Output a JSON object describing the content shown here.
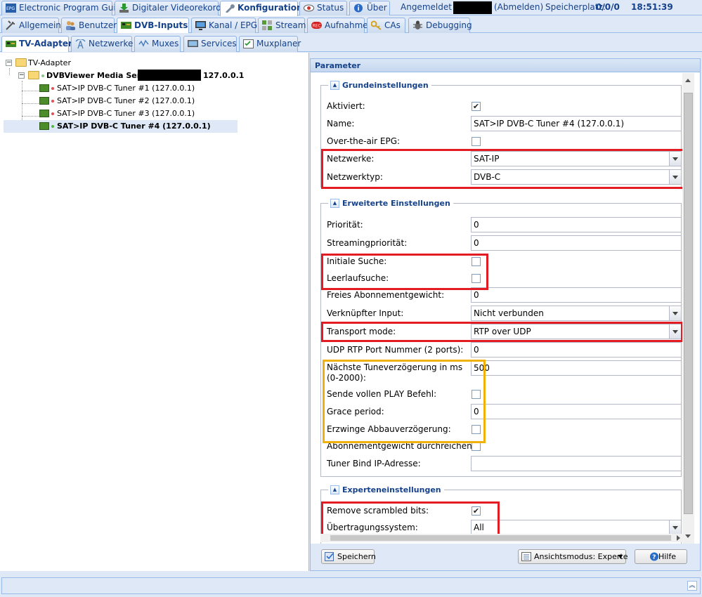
{
  "top_tabs": [
    {
      "label": "Electronic Program Guide",
      "icon": "epg-icon"
    },
    {
      "label": "Digitaler Videorekorder",
      "icon": "download-icon"
    },
    {
      "label": "Konfiguration",
      "icon": "wrench-icon"
    },
    {
      "label": "Status",
      "icon": "eye-icon"
    },
    {
      "label": "Über",
      "icon": "info-icon"
    }
  ],
  "top_info": {
    "logged_in": "Angemeldet als",
    "logout": "(Abmelden)",
    "storage_label": "Speicherplatz:",
    "storage_value": "0/0/0",
    "time": "18:51:39"
  },
  "config_tabs": [
    {
      "label": "Allgemein",
      "icon": "tools-icon"
    },
    {
      "label": "Benutzer",
      "icon": "users-icon"
    },
    {
      "label": "DVB-Inputs",
      "icon": "tuner-card-icon"
    },
    {
      "label": "Kanal / EPG",
      "icon": "tv-icon"
    },
    {
      "label": "Stream",
      "icon": "stream-icon"
    },
    {
      "label": "Aufnahme",
      "icon": "rec-icon"
    },
    {
      "label": "CAs",
      "icon": "key-icon"
    },
    {
      "label": "Debugging",
      "icon": "bug-icon"
    }
  ],
  "dvb_tabs": [
    {
      "label": "TV-Adapter",
      "icon": "tuner-card-icon"
    },
    {
      "label": "Netzwerke",
      "icon": "antenna-icon"
    },
    {
      "label": "Muxes",
      "icon": "mux-icon"
    },
    {
      "label": "Services",
      "icon": "services-icon"
    },
    {
      "label": "Muxplaner",
      "icon": "checklist-icon"
    }
  ],
  "tree": {
    "root": "TV-Adapter",
    "server_name": "DVBViewer Media Server",
    "server_ip": "127.0.0.1",
    "tuners": [
      {
        "label": "SAT>IP DVB-C Tuner #1 (127.0.0.1)",
        "status_color": "#e0505a"
      },
      {
        "label": "SAT>IP DVB-C Tuner #2 (127.0.0.1)",
        "status_color": "#e0505a"
      },
      {
        "label": "SAT>IP DVB-C Tuner #3 (127.0.0.1)",
        "status_color": "#e0505a"
      },
      {
        "label": "SAT>IP DVB-C Tuner #4 (127.0.0.1)",
        "status_color": "#4cbb3f"
      }
    ]
  },
  "params": {
    "title": "Parameter",
    "basic": {
      "legend": "Grundeinstellungen",
      "enabled_label": "Aktiviert:",
      "enabled": true,
      "name_label": "Name:",
      "name_value": "SAT>IP DVB-C Tuner #4 (127.0.0.1)",
      "ota_epg_label": "Over-the-air EPG:",
      "ota_epg": false,
      "networks_label": "Netzwerke:",
      "networks_value": "SAT-IP",
      "network_type_label": "Netzwerktyp:",
      "network_type_value": "DVB-C"
    },
    "advanced": {
      "legend": "Erweiterte Einstellungen",
      "priority_label": "Priorität:",
      "priority_value": "0",
      "stream_priority_label": "Streamingpriorität:",
      "stream_priority_value": "0",
      "initial_scan_label": "Initiale Suche:",
      "initial_scan": false,
      "idle_scan_label": "Leerlaufsuche:",
      "idle_scan": false,
      "free_sub_weight_label": "Freies Abonnementgewicht:",
      "free_sub_weight_value": "0",
      "linked_input_label": "Verknüpfter Input:",
      "linked_input_value": "Nicht verbunden",
      "transport_mode_label": "Transport mode:",
      "transport_mode_value": "RTP over UDP",
      "udp_rtp_port_label": "UDP RTP Port Nummer (2 ports):",
      "udp_rtp_port_value": "0",
      "tune_delay_label": "Nächste Tuneverzögerung in ms (0-2000):",
      "tune_delay_value": "500",
      "full_play_label": "Sende vollen PLAY Befehl:",
      "full_play": false,
      "grace_period_label": "Grace period:",
      "grace_period_value": "0",
      "force_teardown_label": "Erzwinge Abbauverzögerung:",
      "force_teardown": false,
      "pass_sub_weight_label": "Abonnementgewicht durchreichen:",
      "pass_sub_weight": false,
      "bind_ip_label": "Tuner Bind IP-Adresse:",
      "bind_ip_value": ""
    },
    "expert": {
      "legend": "Experteneinstellungen",
      "remove_scrambled_label": "Remove scrambled bits:",
      "remove_scrambled": true,
      "delivery_system_label": "Übertragungssystem:",
      "delivery_system_value": "All"
    }
  },
  "footer": {
    "save": "Speichern",
    "view_mode": "Ansichtsmodus: Experte",
    "help": "Hilfe"
  },
  "colors": {
    "highlight_red": "#e31b23",
    "highlight_yellow": "#f0b20a",
    "accent": "#15428b"
  }
}
